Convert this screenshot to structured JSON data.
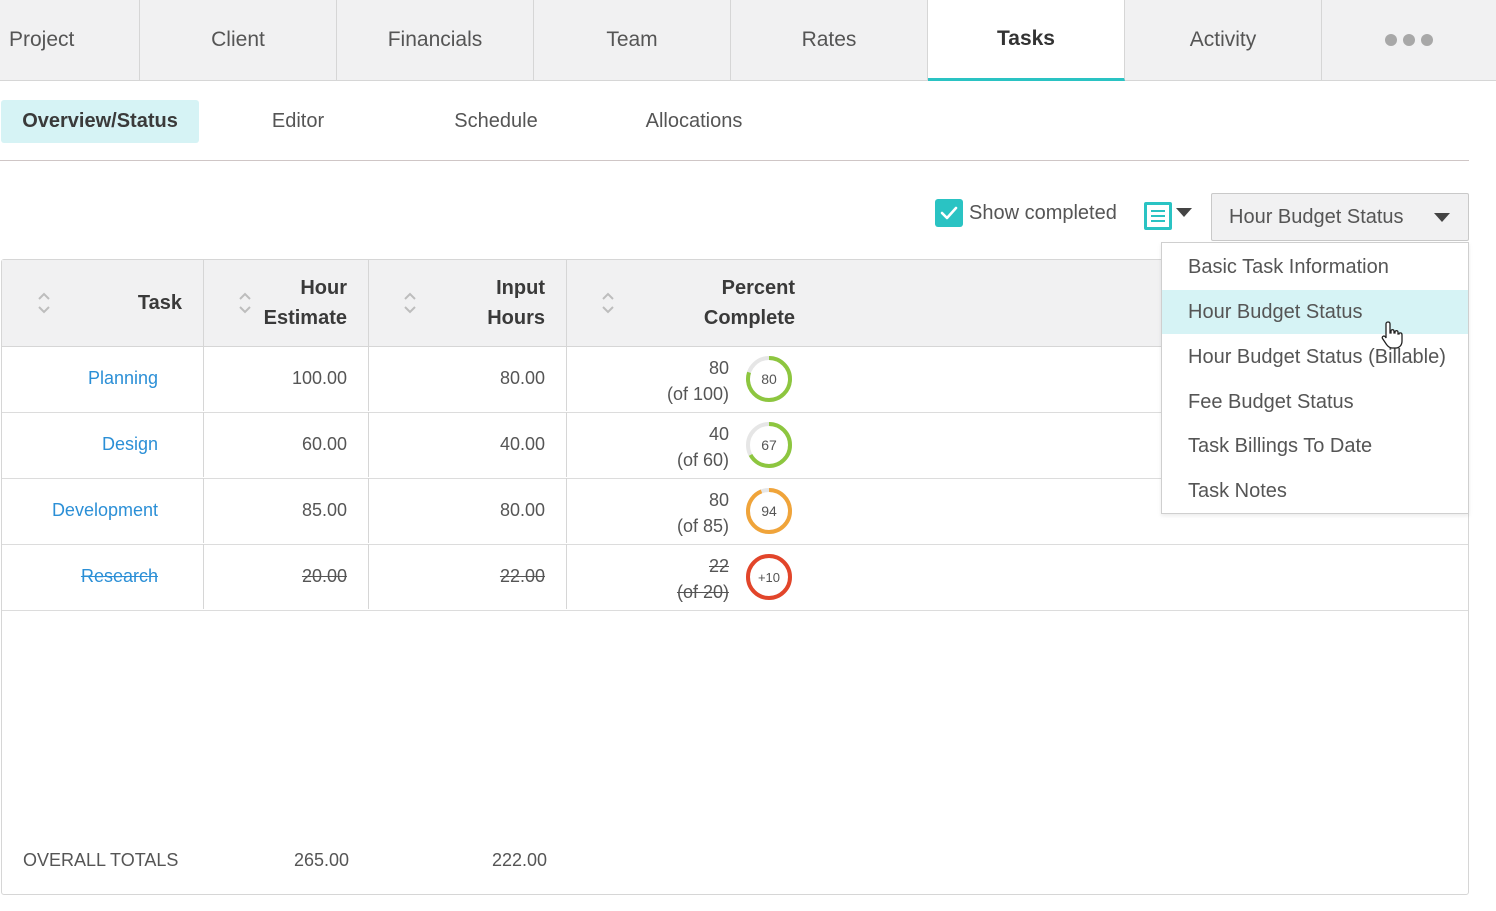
{
  "top_tabs": [
    {
      "label": "Project"
    },
    {
      "label": "Client"
    },
    {
      "label": "Financials"
    },
    {
      "label": "Team"
    },
    {
      "label": "Rates"
    },
    {
      "label": "Tasks",
      "active": true
    },
    {
      "label": "Activity"
    },
    {
      "icon": "more-icon"
    }
  ],
  "sub_tabs": [
    {
      "label": "Overview/Status",
      "active": true
    },
    {
      "label": "Editor"
    },
    {
      "label": "Schedule"
    },
    {
      "label": "Allocations"
    }
  ],
  "toolbar": {
    "show_completed_label": "Show completed",
    "show_completed_checked": true,
    "view_select_value": "Hour Budget Status"
  },
  "table": {
    "headers": {
      "task": "Task",
      "hour_estimate_1": "Hour",
      "hour_estimate_2": "Estimate",
      "input_hours_1": "Input",
      "input_hours_2": "Hours",
      "percent_1": "Percent",
      "percent_2": "Complete"
    },
    "rows": [
      {
        "task": "Planning",
        "estimate": "100.00",
        "input": "80.00",
        "used": "80",
        "of": "(of 100)",
        "ring_label": "80",
        "ring_fraction": 0.8,
        "ring_color": "#8dc63f",
        "completed": false
      },
      {
        "task": "Design",
        "estimate": "60.00",
        "input": "40.00",
        "used": "40",
        "of": "(of 60)",
        "ring_label": "67",
        "ring_fraction": 0.67,
        "ring_color": "#8dc63f",
        "completed": false
      },
      {
        "task": "Development",
        "estimate": "85.00",
        "input": "80.00",
        "used": "80",
        "of": "(of 85)",
        "ring_label": "94",
        "ring_fraction": 0.94,
        "ring_color": "#f0a43a",
        "completed": false
      },
      {
        "task": "Research",
        "estimate": "20.00",
        "input": "22.00",
        "used": "22",
        "of": "(of 20)",
        "ring_label": "+10",
        "ring_fraction": 1.0,
        "ring_color": "#e2452a",
        "completed": true
      }
    ],
    "totals": {
      "label": "OVERALL TOTALS",
      "estimate": "265.00",
      "input": "222.00"
    }
  },
  "dropdown": {
    "items": [
      {
        "label": "Basic Task Information"
      },
      {
        "label": "Hour Budget Status",
        "highlighted": true
      },
      {
        "label": "Hour Budget Status (Billable)"
      },
      {
        "label": "Fee Budget Status"
      },
      {
        "label": "Task Billings To Date"
      },
      {
        "label": "Task Notes"
      }
    ]
  },
  "colors": {
    "accent": "#2ac3c3",
    "link": "#2b8fd6",
    "track": "#e6e6e6"
  }
}
